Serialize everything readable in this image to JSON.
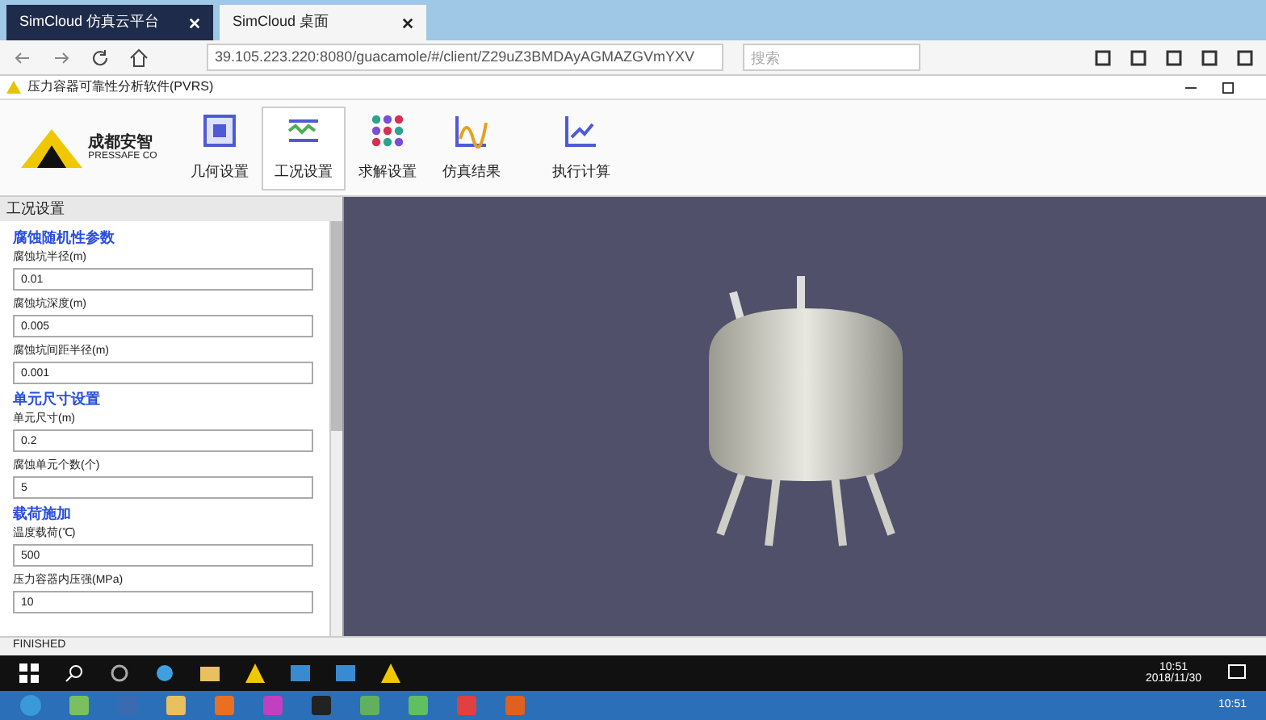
{
  "browser_tabs": [
    {
      "label": "SimCloud 仿真云平台",
      "selected": false
    },
    {
      "label": "SimCloud 桌面",
      "selected": true
    }
  ],
  "address": "39.105.223.220:8080/guacamole/#/client/Z29uZ3BMDAyAGMAZGVmYXV",
  "search": {
    "placeholder": "搜索"
  },
  "app": {
    "title": "压力容器可靠性分析软件(PVRS)",
    "logo": "成都安智",
    "logo_sub": "PRESSAFE CO"
  },
  "toolbar": [
    {
      "label": "几何设置",
      "kind": "geometry",
      "selected": false
    },
    {
      "label": "工况设置",
      "kind": "wave",
      "selected": true
    },
    {
      "label": "求解设置",
      "kind": "dots",
      "selected": false
    },
    {
      "label": "仿真结果",
      "kind": "chart",
      "selected": false
    },
    {
      "label": "执行计算",
      "kind": "run",
      "selected": false
    }
  ],
  "panel": {
    "title": "工况设置",
    "items": [
      {
        "kind": "section",
        "text": "腐蚀随机性参数"
      },
      {
        "kind": "field",
        "label": "腐蚀坑半径(m)",
        "value": "0.01"
      },
      {
        "kind": "field",
        "label": "腐蚀坑深度(m)",
        "value": "0.005"
      },
      {
        "kind": "field",
        "label": "腐蚀坑间距半径(m)",
        "value": "0.001"
      },
      {
        "kind": "section",
        "text": "单元尺寸设置"
      },
      {
        "kind": "field",
        "label": "单元尺寸(m)",
        "value": "0.2"
      },
      {
        "kind": "field",
        "label": "腐蚀单元个数(个)",
        "value": "5"
      },
      {
        "kind": "section",
        "text": "载荷施加"
      },
      {
        "kind": "field",
        "label": "温度载荷(℃)",
        "value": "500"
      },
      {
        "kind": "field",
        "label": "压力容器内压强(MPa)",
        "value": "10"
      }
    ]
  },
  "status": "FINISHED",
  "taskbar": {
    "time": "10:51",
    "date": "2018/11/30"
  },
  "taskbar2": {
    "time": "10:51"
  }
}
